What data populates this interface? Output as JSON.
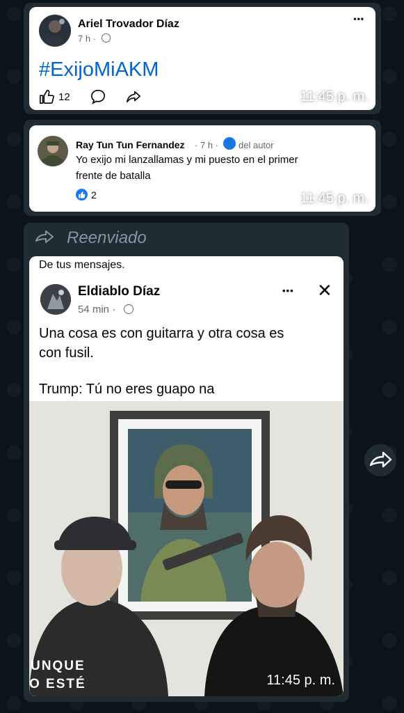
{
  "post1": {
    "author": "Ariel Trovador Díaz",
    "meta": "7 h ·",
    "more": "•••",
    "hashtag": "#ExijoMiAKM",
    "like_count": "12",
    "time": "11:45 p. m."
  },
  "post2": {
    "author": "Ray Tun Tun Fernandez",
    "meta": "· 7 h ·",
    "author_badge": "del autor",
    "comment_line1": "Yo exijo mi lanzallamas y mi puesto en el primer",
    "comment_line2": "frente de batalla",
    "like_count": "2",
    "time": "11:45 p. m."
  },
  "forwarded": {
    "label": "Reenviado",
    "header_text": "De tus mensajes.",
    "author": "Eldiablo Díaz",
    "meta": "54 min ·",
    "more": "•••",
    "close": "✕",
    "text_line1": "Una cosa es con guitarra y otra cosa es",
    "text_line2": "con fusil.",
    "text_line3": "Trump: Tú no eres guapo na",
    "shirt_text1": "UNQUE",
    "shirt_text2": "O ESTÉ",
    "time": "11:45 p. m."
  },
  "colors": {
    "chat_bg": "#0b141a",
    "bubble": "#1f2c34",
    "hashtag": "#0064d1",
    "like_blue": "#1877f2"
  }
}
